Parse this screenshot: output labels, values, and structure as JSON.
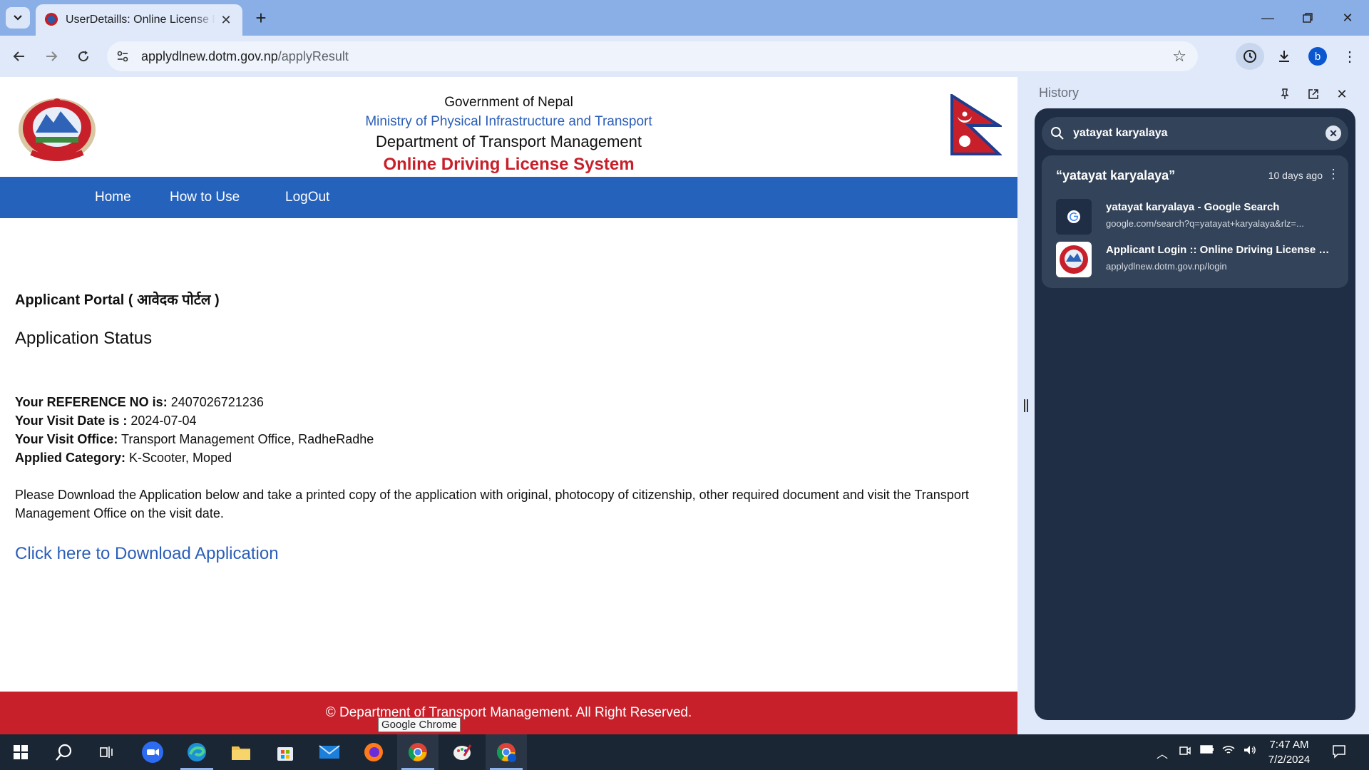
{
  "browser": {
    "tab_title": "UserDetaills: Online License Registration",
    "url_host": "applydlnew.dotm.gov.np",
    "url_path": "/applyResult",
    "window_controls": [
      "minimize-icon",
      "restore-icon",
      "close-icon"
    ]
  },
  "page": {
    "header": {
      "line1": "Government of Nepal",
      "line2": "Ministry of Physical Infrastructure and Transport",
      "line3": "Department of Transport Management",
      "line4": "Online Driving License System"
    },
    "nav": [
      "Home",
      "How to Use",
      "LogOut"
    ],
    "portal_label": "Applicant Portal ( आवेदक पोर्टल )",
    "status_title": "Application Status",
    "info": {
      "ref_label": "Your REFERENCE NO is:",
      "ref_value": " 2407026721236",
      "date_label": "Your Visit Date is :",
      "date_value": " 2024-07-04",
      "office_label": "Your Visit Office:",
      "office_value": " Transport Management Office, RadheRadhe",
      "category_label": "Applied Category:",
      "category_value": " K-Scooter, Moped"
    },
    "instructions": "Please Download the Application below and take a printed copy of the application with original, photocopy of citizenship, other required document and visit the Transport Management Office on the visit date.",
    "download_link": "Click here to Download Application",
    "footer": "© Department of Transport Management. All Right Reserved.",
    "tooltip": "Google Chrome"
  },
  "history_panel": {
    "title": "History",
    "search_query": "yatayat karyalaya",
    "group_title": "“yatayat karyalaya”",
    "group_time": "10 days ago",
    "items": [
      {
        "title": "yatayat karyalaya - Google Search",
        "url": "google.com/search?q=yatayat+karyalaya&rlz=..."
      },
      {
        "title": "Applicant Login :: Online Driving License System",
        "url": "applydlnew.dotm.gov.np/login"
      }
    ]
  },
  "taskbar": {
    "apps": [
      "windows-start-icon",
      "search-icon",
      "task-view-icon",
      "zoom-icon",
      "edge-icon",
      "file-explorer-icon",
      "store-icon",
      "mail-icon",
      "firefox-icon",
      "chrome-icon",
      "paint-icon",
      "chrome-profile-icon"
    ],
    "time": "7:47 AM",
    "date": "7/2/2024"
  },
  "colors": {
    "nav_blue": "#2462bc",
    "footer_red": "#c8202a",
    "link_blue": "#2b5eb8",
    "panel_dark": "#1f2e44"
  }
}
